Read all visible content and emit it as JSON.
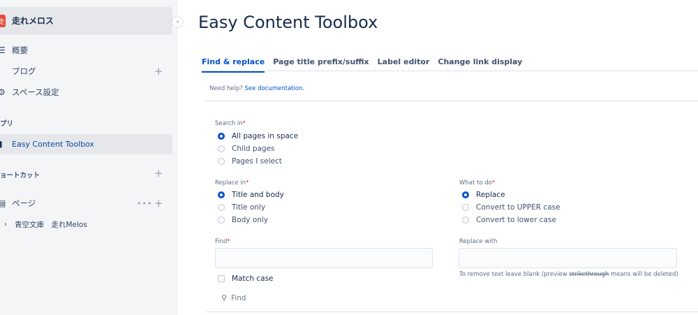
{
  "sidebar": {
    "space_name": "走れメロス",
    "space_avatar_text": "走",
    "nav": [
      {
        "label": "概要",
        "icon": "menu-icon"
      },
      {
        "label": "ブログ",
        "icon": "quote-icon"
      },
      {
        "label": "スペース設定",
        "icon": "gear-icon"
      }
    ],
    "apps_section": "プリ",
    "app_item": "Easy Content Toolbox",
    "shortcuts_section": "ョートカット",
    "pages_label": "ページ",
    "tree_item": "青空文庫　走れMelos"
  },
  "main": {
    "title": "Easy Content Toolbox",
    "tabs": [
      {
        "label": "Find & replace",
        "active": true
      },
      {
        "label": "Page title prefix/suffix",
        "active": false
      },
      {
        "label": "Label editor",
        "active": false
      },
      {
        "label": "Change link display",
        "active": false
      }
    ],
    "help_text": "Need help?",
    "help_link": "See documentation.",
    "search_in": {
      "label": "Search in",
      "options": [
        "All pages in space",
        "Child pages",
        "Pages I select"
      ],
      "selected": "All pages in space"
    },
    "replace_in": {
      "label": "Replace in",
      "options": [
        "Title and body",
        "Title only",
        "Body only"
      ],
      "selected": "Title and body"
    },
    "what_to_do": {
      "label": "What to do",
      "options": [
        "Replace",
        "Convert to UPPER case",
        "Convert to lower case"
      ],
      "selected": "Replace"
    },
    "find": {
      "label": "Find",
      "value": ""
    },
    "replace_with": {
      "label": "Replace with",
      "value": ""
    },
    "hint_prefix": "To remove text leave blank (preview",
    "hint_strike": "strikethrough",
    "hint_suffix": "means will be deleted)",
    "match_case": "Match case",
    "find_button": "Find"
  },
  "colors": {
    "accent": "#0052cc",
    "required": "#de350b",
    "avatar": "#e5493a"
  }
}
